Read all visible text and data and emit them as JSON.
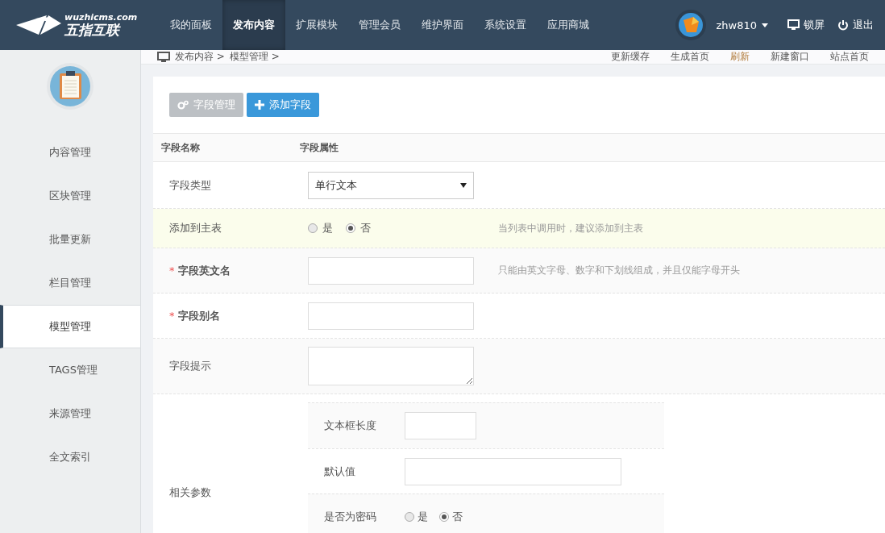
{
  "header": {
    "logo": {
      "domain": "wuzhicms.com",
      "name": "五指互联"
    },
    "nav": [
      {
        "label": "我的面板",
        "selected": false
      },
      {
        "label": "发布内容",
        "selected": true
      },
      {
        "label": "扩展模块",
        "selected": false
      },
      {
        "label": "管理会员",
        "selected": false
      },
      {
        "label": "维护界面",
        "selected": false
      },
      {
        "label": "系统设置",
        "selected": false
      },
      {
        "label": "应用商城",
        "selected": false
      }
    ],
    "user": {
      "name": "zhw810"
    },
    "actions": [
      {
        "label": "锁屏",
        "kind": "lock"
      },
      {
        "label": "退出",
        "kind": "logout"
      }
    ]
  },
  "sidebar": {
    "items": [
      {
        "label": "内容管理",
        "selected": false
      },
      {
        "label": "区块管理",
        "selected": false
      },
      {
        "label": "批量更新",
        "selected": false
      },
      {
        "label": "栏目管理",
        "selected": false
      },
      {
        "label": "模型管理",
        "selected": true
      },
      {
        "label": "TAGS管理",
        "selected": false
      },
      {
        "label": "来源管理",
        "selected": false
      },
      {
        "label": "全文索引",
        "selected": false
      }
    ]
  },
  "breadcrumb": [
    "发布内容 >",
    "模型管理 >"
  ],
  "toolbar_links": [
    {
      "label": "更新缓存",
      "highlight": false
    },
    {
      "label": "生成首页",
      "highlight": false
    },
    {
      "label": "刷新",
      "highlight": true
    },
    {
      "label": "新建窗口",
      "highlight": false
    },
    {
      "label": "站点首页",
      "highlight": false
    }
  ],
  "buttons": [
    {
      "label": "字段管理",
      "kind": "gear",
      "selected": true
    },
    {
      "label": "添加字段",
      "kind": "plus",
      "selected": false
    }
  ],
  "table": {
    "columns": [
      "字段名称",
      "字段属性"
    ],
    "rows": [
      {
        "kind": "select",
        "label": "字段类型",
        "highlight": false,
        "value": "单行文本"
      },
      {
        "kind": "radio",
        "label": "添加到主表",
        "highlight": true,
        "options": [
          {
            "label": "是",
            "selected": false
          },
          {
            "label": "否",
            "selected": true
          }
        ],
        "hint": "当列表中调用时，建议添加到主表"
      },
      {
        "kind": "text",
        "label": "字段英文名",
        "required_mark": "*",
        "highlight": false,
        "hint": "只能由英文字母、数字和下划线组成，并且仅能字母开头"
      },
      {
        "kind": "text",
        "label": "字段别名",
        "required_mark": "*",
        "highlight": false
      },
      {
        "kind": "textarea",
        "label": "字段提示",
        "highlight": false
      },
      {
        "kind": "params",
        "label": "相关参数",
        "highlight": false,
        "params": [
          {
            "kind": "short",
            "label": "文本框长度"
          },
          {
            "kind": "text",
            "label": "默认值"
          },
          {
            "kind": "radio",
            "label": "是否为密码",
            "options": [
              {
                "label": "是",
                "selected": false
              },
              {
                "label": "否",
                "selected": true
              }
            ]
          }
        ]
      }
    ]
  }
}
